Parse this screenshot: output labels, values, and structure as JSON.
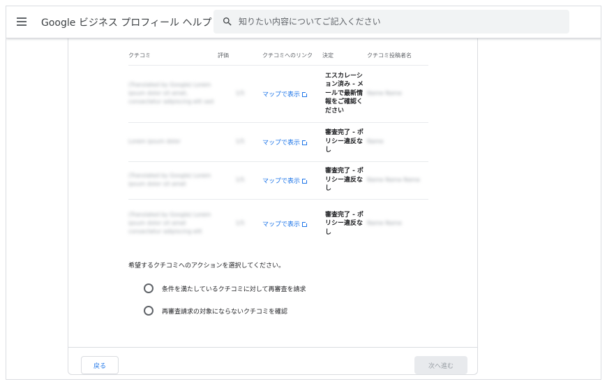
{
  "header": {
    "brand": "Google ビジネス プロフィール ヘルプ",
    "search_placeholder": "知りたい内容についてご記入ください"
  },
  "table": {
    "columns": [
      "クチコミ",
      "評価",
      "クチコミへのリンク",
      "決定",
      "クチコミ投稿者名"
    ],
    "rows": [
      {
        "review": "(Translated by Google) Lorem ipsum dolor sit amet, consectetur adipiscing elit sed",
        "rating": "1/5",
        "link": "マップで表示",
        "decision": "エスカレーション済み - メールで最新情報をご確認ください",
        "author": "Name Name"
      },
      {
        "review": "Lorem ipsum dolor",
        "rating": "1/5",
        "link": "マップで表示",
        "decision": "審査完了 - ポリシー違反なし",
        "author": "Name"
      },
      {
        "review": "(Translated by Google) Lorem ipsum dolor sit amet",
        "rating": "1/5",
        "link": "マップで表示",
        "decision": "審査完了 - ポリシー違反なし",
        "author": "Name Name Name"
      },
      {
        "review": "(Translated by Google) Lorem ipsum dolor sit amet consectetur adipiscing elit",
        "rating": "1/5",
        "link": "マップで表示",
        "decision": "審査完了 - ポリシー違反なし",
        "author": "Name Name"
      }
    ]
  },
  "prompt": "希望するクチコミへのアクションを選択してください。",
  "options": [
    "条件を満たしているクチコミに対して再審査を請求",
    "再審査請求の対象にならないクチコミを確認"
  ],
  "footer": {
    "back_label": "戻る",
    "next_label": "次へ進む"
  },
  "colors": {
    "link": "#1a73e8",
    "disabled_button": "#e8eaed",
    "border": "#dadce0"
  }
}
